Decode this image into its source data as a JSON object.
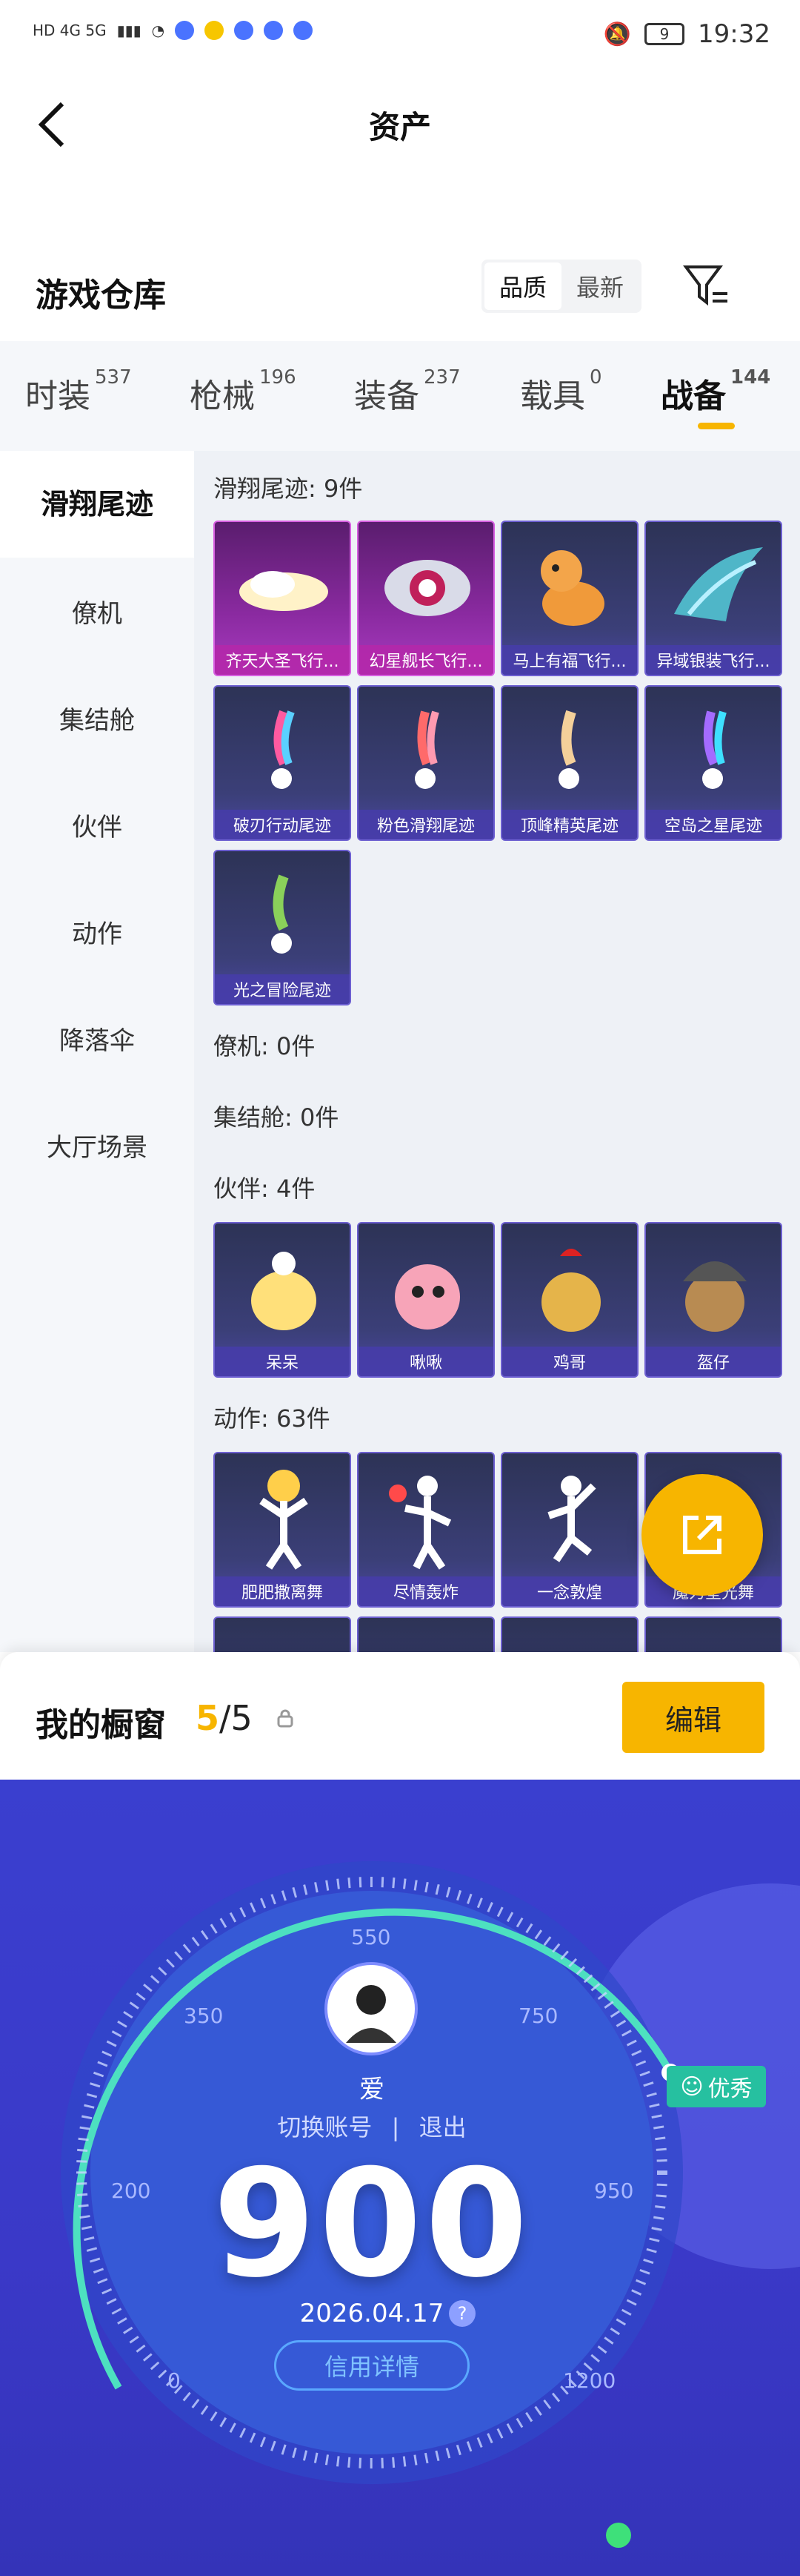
{
  "status": {
    "left_text": "HD 4G 5G",
    "battery": "9",
    "time": "19:32"
  },
  "header": {
    "title": "资产"
  },
  "section": {
    "title": "游戏仓库",
    "sort": [
      "品质",
      "最新"
    ]
  },
  "tabs": [
    {
      "label": "时装",
      "count": "537"
    },
    {
      "label": "枪械",
      "count": "196"
    },
    {
      "label": "装备",
      "count": "237"
    },
    {
      "label": "载具",
      "count": "0"
    },
    {
      "label": "战备",
      "count": "144"
    }
  ],
  "sidebar": [
    "滑翔尾迹",
    "僚机",
    "集结舱",
    "伙伴",
    "动作",
    "降落伞",
    "大厅场景"
  ],
  "categories": {
    "trail": "滑翔尾迹: 9件",
    "wingman": "僚机: 0件",
    "pod": "集结舱: 0件",
    "partner": "伙伴: 4件",
    "action": "动作: 63件"
  },
  "trail_items": [
    "齐天大圣飞行...",
    "幻星舰长飞行...",
    "马上有福飞行...",
    "异域银装飞行...",
    "破刃行动尾迹",
    "粉色滑翔尾迹",
    "顶峰精英尾迹",
    "空岛之星尾迹",
    "光之冒险尾迹"
  ],
  "partner_items": [
    "呆呆",
    "啾啾",
    "鸡哥",
    "盔仔"
  ],
  "action_items": [
    "肥肥撒离舞",
    "尽情轰炸",
    "一念敦煌",
    "魔力星光舞"
  ],
  "window": {
    "title": "我的橱窗",
    "count_a": "5",
    "count_b": "/5",
    "edit": "编辑"
  },
  "credit": {
    "ticks": [
      "0",
      "200",
      "350",
      "550",
      "750",
      "950",
      "1200"
    ],
    "name": "爱",
    "switch": "切换账号",
    "sep": "|",
    "logout": "退出",
    "score": "900",
    "date": "2026.04.17",
    "help": "?",
    "detail": "信用详情",
    "badge": "优秀"
  }
}
